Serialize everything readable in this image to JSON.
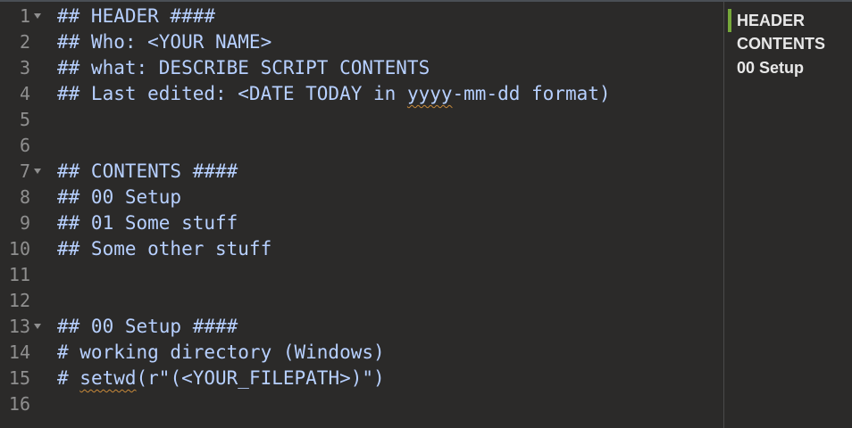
{
  "editor": {
    "lines": [
      {
        "num": "1",
        "text": "## HEADER ####"
      },
      {
        "num": "2",
        "text": "## Who: <YOUR NAME>"
      },
      {
        "num": "3",
        "text": "## what: DESCRIBE SCRIPT CONTENTS"
      },
      {
        "num": "4",
        "pre": "## Last edited: <DATE TODAY in ",
        "spell": "yyyy",
        "post": "-mm-dd format)"
      },
      {
        "num": "5",
        "text": ""
      },
      {
        "num": "6",
        "text": ""
      },
      {
        "num": "7",
        "text": "## CONTENTS ####"
      },
      {
        "num": "8",
        "text": "## 00 Setup"
      },
      {
        "num": "9",
        "text": "## 01 Some stuff"
      },
      {
        "num": "10",
        "text": "## Some other stuff"
      },
      {
        "num": "11",
        "text": ""
      },
      {
        "num": "12",
        "text": ""
      },
      {
        "num": "13",
        "text": "## 00 Setup ####"
      },
      {
        "num": "14",
        "text": "# working directory (Windows)"
      },
      {
        "num": "15",
        "pre": "# ",
        "spell": "setwd",
        "post": "(r\"(<YOUR_FILEPATH>)\")"
      },
      {
        "num": "16",
        "text": ""
      }
    ]
  },
  "outline": {
    "items": [
      {
        "label": "HEADER"
      },
      {
        "label": "CONTENTS"
      },
      {
        "label": "00 Setup"
      }
    ]
  }
}
